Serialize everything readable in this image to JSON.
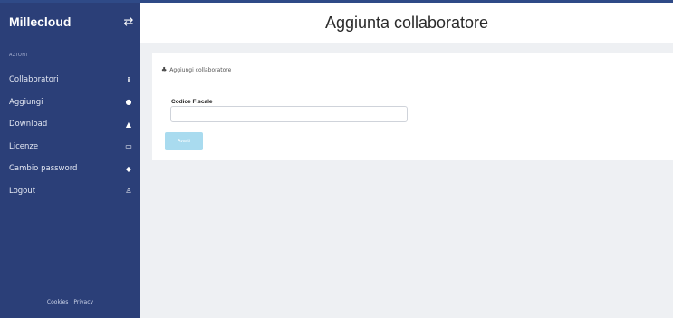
{
  "sidebar": {
    "brand": "Millecloud",
    "section_label": "AZIONI",
    "items": [
      {
        "label": "Collaboratori",
        "icon": "info-icon",
        "glyph": "i"
      },
      {
        "label": "Aggiungi",
        "icon": "add-circle-icon",
        "glyph": "●"
      },
      {
        "label": "Download",
        "icon": "download-icon",
        "glyph": "▲"
      },
      {
        "label": "Licenze",
        "icon": "card-icon",
        "glyph": "▭"
      },
      {
        "label": "Cambio password",
        "icon": "shield-icon",
        "glyph": "◆"
      },
      {
        "label": "Logout",
        "icon": "user-icon",
        "glyph": "♙"
      }
    ],
    "footer": {
      "cookies": "Cookies",
      "privacy": "Privacy"
    }
  },
  "header": {
    "title": "Aggiunta collaboratore"
  },
  "main": {
    "breadcrumb": "Aggiungi collaboratore",
    "field_label": "Codice Fiscale",
    "field_value": "",
    "submit_label": "Avanti"
  },
  "colors": {
    "sidebar": "#2b3f78",
    "button": "#a9dbef",
    "background": "#eef0f3"
  }
}
